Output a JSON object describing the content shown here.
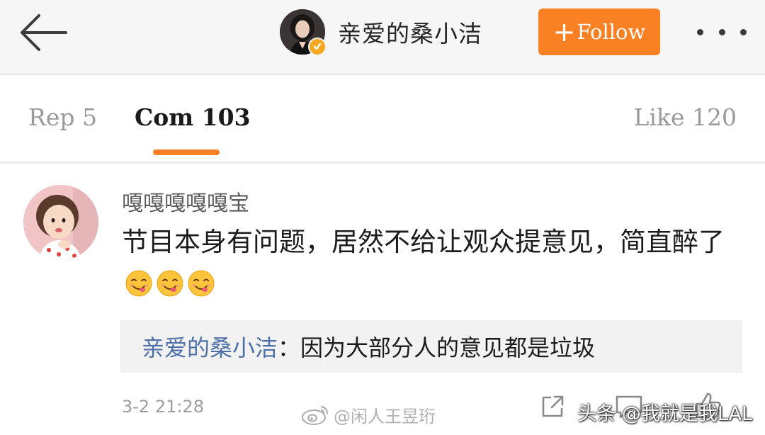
{
  "header": {
    "back_icon": "arrow-left-icon",
    "author_name": "亲爱的桑小洁",
    "verified_icon": "verified-badge-icon",
    "follow_label": "Follow",
    "follow_plus": "+",
    "more_icon": "more-dots-icon"
  },
  "tabs": [
    {
      "label": "Rep 5"
    },
    {
      "label": "Com 103"
    },
    {
      "label": "Like 120"
    }
  ],
  "active_tab": "Com 103",
  "comment": {
    "username": "嘎嘎嘎嘎嘎宝",
    "text": "节目本身有问题，居然不给让观众提意见，简直醉了",
    "emojis": [
      "yummy-face-icon",
      "yummy-face-icon",
      "yummy-face-icon"
    ],
    "reply": {
      "author": "亲爱的桑小洁",
      "separator": "：",
      "text": "因为大部分人的意见都是垃圾"
    },
    "timestamp": "3-2 21:28"
  },
  "actions": {
    "forward_icon": "forward-icon",
    "reply_icon": "comment-icon",
    "like_icon": "thumbs-up-icon"
  },
  "watermarks": {
    "weibo": "@闲人王昱珩",
    "toutiao": "头条 @我就是我LAL"
  },
  "colors": {
    "accent": "#f98123",
    "reply_author": "#4d6fa8",
    "header_bg": "#f6f6f6",
    "verified": "#f6a821"
  }
}
